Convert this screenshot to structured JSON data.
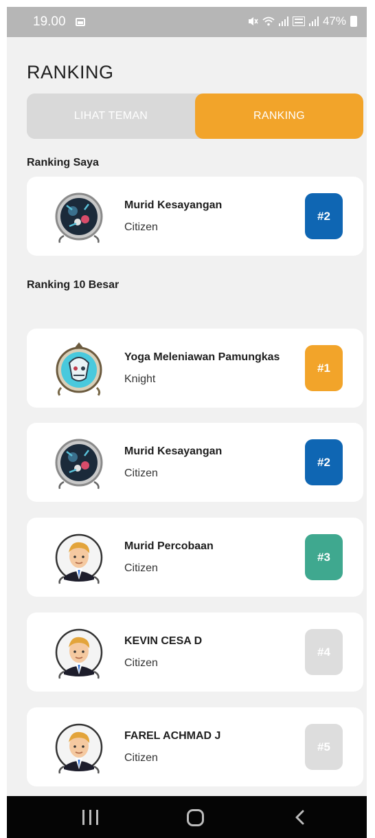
{
  "status_bar": {
    "time": "19.00",
    "battery": "47%",
    "icons": [
      "image-notification-icon",
      "mute-icon",
      "wifi-icon",
      "signal-icon",
      "volte-icon",
      "signal-icon",
      "battery-icon"
    ]
  },
  "page": {
    "title": "RANKING"
  },
  "tabs": [
    {
      "label": "LIHAT TEMAN",
      "active": false
    },
    {
      "label": "RANKING",
      "active": true
    }
  ],
  "my_ranking": {
    "section_label": "Ranking Saya",
    "entry": {
      "name": "Murid Kesayangan",
      "title": "Citizen",
      "rank": "#2",
      "badge_color": "#0f66b3",
      "avatar": "monster-avatar"
    }
  },
  "top10": {
    "section_label": "Ranking 10 Besar",
    "entries": [
      {
        "name": "Yoga Meleniawan Pamungkas",
        "title": "Knight",
        "rank": "#1",
        "badge_color": "#f2a42a",
        "avatar": "knight-avatar"
      },
      {
        "name": "Murid Kesayangan",
        "title": "Citizen",
        "rank": "#2",
        "badge_color": "#0f66b3",
        "avatar": "monster-avatar"
      },
      {
        "name": "Murid Percobaan",
        "title": "Citizen",
        "rank": "#3",
        "badge_color": "#3fa88f",
        "avatar": "businessman-avatar"
      },
      {
        "name": "KEVIN CESA D",
        "title": "Citizen",
        "rank": "#4",
        "badge_color": "#dddddd",
        "avatar": "businessman-avatar"
      },
      {
        "name": "FAREL ACHMAD J",
        "title": "Citizen",
        "rank": "#5",
        "badge_color": "#dddddd",
        "avatar": "businessman-avatar"
      }
    ]
  },
  "colors": {
    "accent": "#f2a42a",
    "background": "#f1f1f1",
    "tab_inactive": "#d9d9d9"
  }
}
